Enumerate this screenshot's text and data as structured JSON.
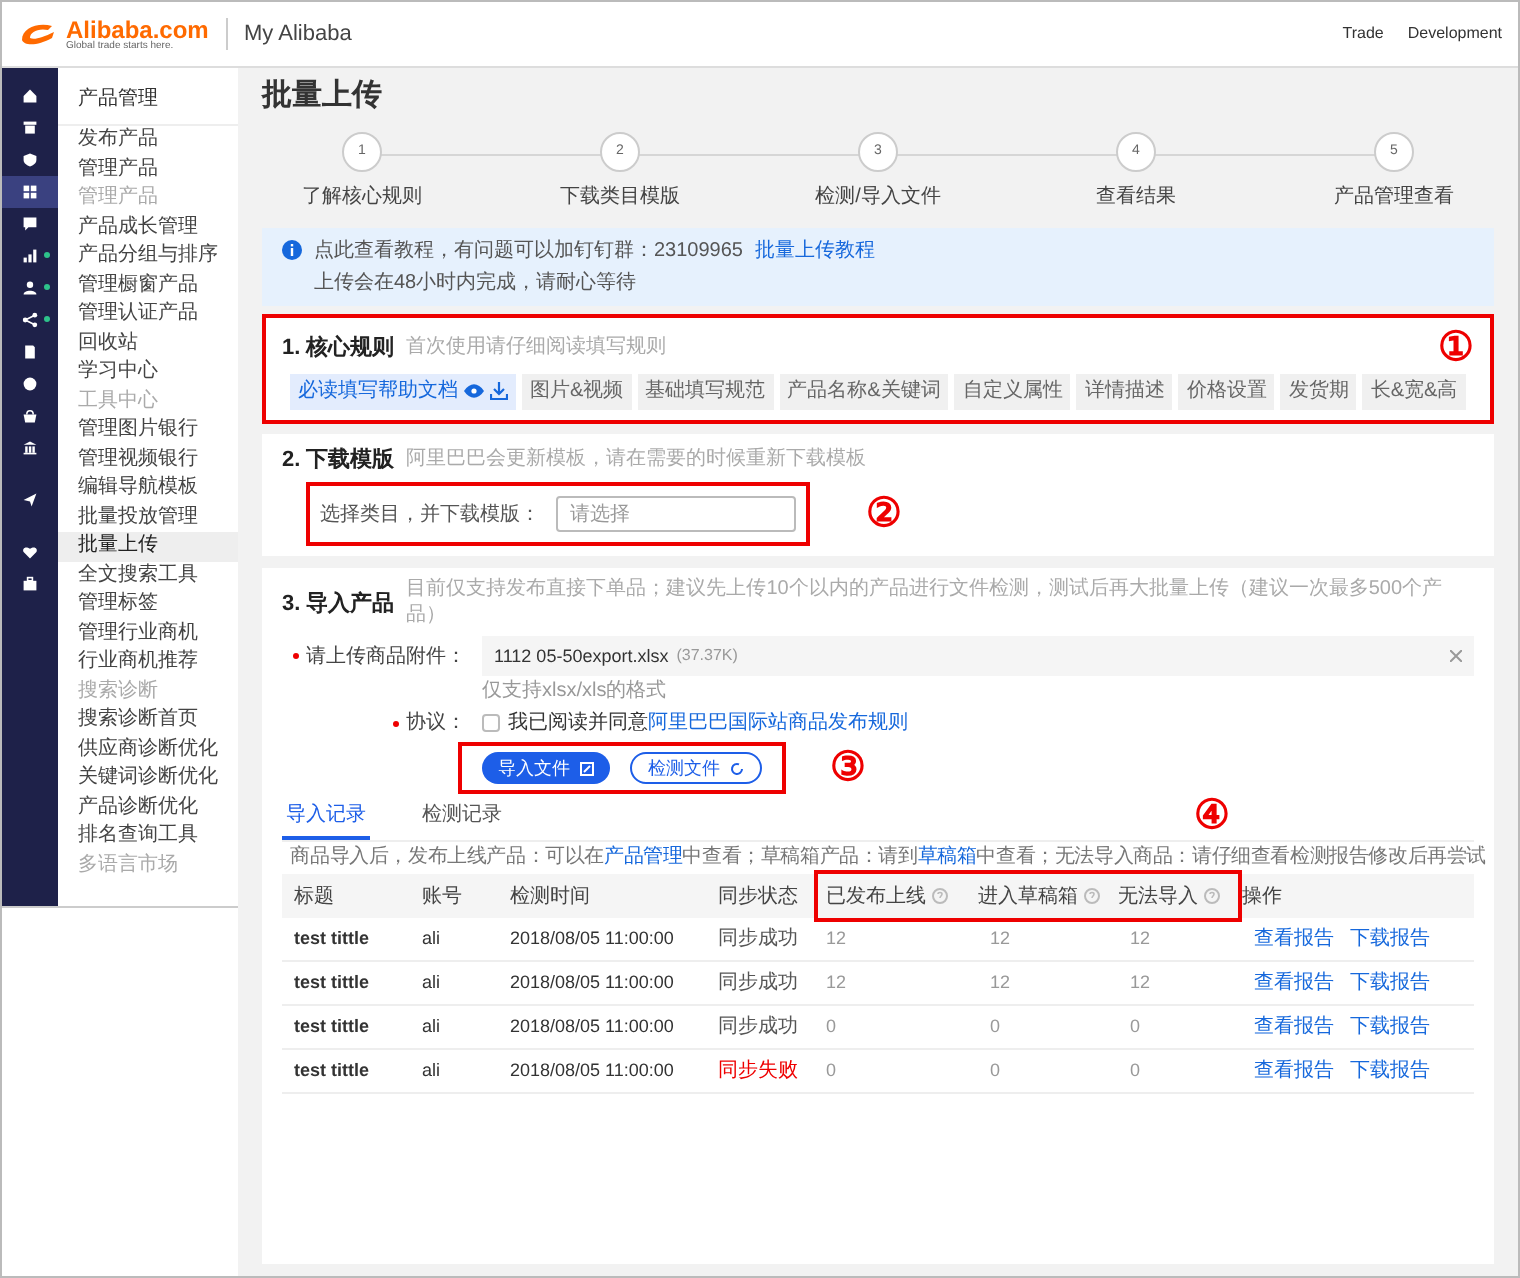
{
  "header": {
    "logo": "Alibaba.com",
    "tagline": "Global trade starts here.",
    "title": "My Alibaba",
    "nav": [
      "Trade",
      "Development"
    ]
  },
  "rail": [
    {
      "kind": "home",
      "selected": false,
      "dot": false
    },
    {
      "kind": "box",
      "selected": false,
      "dot": false
    },
    {
      "kind": "shield",
      "selected": false,
      "dot": false
    },
    {
      "kind": "grid",
      "selected": true,
      "dot": false
    },
    {
      "kind": "chat",
      "selected": false,
      "dot": false
    },
    {
      "kind": "chart",
      "selected": false,
      "dot": true
    },
    {
      "kind": "person",
      "selected": false,
      "dot": true
    },
    {
      "kind": "share",
      "selected": false,
      "dot": true
    },
    {
      "kind": "doc",
      "selected": false,
      "dot": false
    },
    {
      "kind": "globe",
      "selected": false,
      "dot": false
    },
    {
      "kind": "bag",
      "selected": false,
      "dot": false
    },
    {
      "kind": "bank",
      "selected": false,
      "dot": false
    },
    {
      "kind": "plane",
      "selected": false,
      "dot": false
    },
    {
      "kind": "heart",
      "selected": false,
      "dot": false
    },
    {
      "kind": "case",
      "selected": false,
      "dot": false
    }
  ],
  "sidebar": {
    "title": "产品管理",
    "items": [
      {
        "kind": "link",
        "label": "发布产品",
        "selected": false
      },
      {
        "kind": "link",
        "label": "管理产品",
        "selected": false
      },
      {
        "kind": "group",
        "label": "管理产品"
      },
      {
        "kind": "link",
        "label": "产品成长管理",
        "selected": false
      },
      {
        "kind": "link",
        "label": "产品分组与排序",
        "selected": false
      },
      {
        "kind": "link",
        "label": "管理橱窗产品",
        "selected": false
      },
      {
        "kind": "link",
        "label": "管理认证产品",
        "selected": false
      },
      {
        "kind": "link",
        "label": "回收站",
        "selected": false
      },
      {
        "kind": "link",
        "label": "学习中心",
        "selected": false
      },
      {
        "kind": "group",
        "label": "工具中心"
      },
      {
        "kind": "link",
        "label": "管理图片银行",
        "selected": false
      },
      {
        "kind": "link",
        "label": "管理视频银行",
        "selected": false
      },
      {
        "kind": "link",
        "label": "编辑导航模板",
        "selected": false
      },
      {
        "kind": "link",
        "label": "批量投放管理",
        "selected": false
      },
      {
        "kind": "link",
        "label": "批量上传",
        "selected": true
      },
      {
        "kind": "link",
        "label": "全文搜索工具",
        "selected": false
      },
      {
        "kind": "link",
        "label": "管理标签",
        "selected": false
      },
      {
        "kind": "link",
        "label": "管理行业商机",
        "selected": false
      },
      {
        "kind": "link",
        "label": "行业商机推荐",
        "selected": false
      },
      {
        "kind": "group",
        "label": "搜索诊断"
      },
      {
        "kind": "link",
        "label": "搜索诊断首页",
        "selected": false
      },
      {
        "kind": "link",
        "label": "供应商诊断优化",
        "selected": false
      },
      {
        "kind": "link",
        "label": "关键词诊断优化",
        "selected": false
      },
      {
        "kind": "link",
        "label": "产品诊断优化",
        "selected": false
      },
      {
        "kind": "link",
        "label": "排名查询工具",
        "selected": false
      },
      {
        "kind": "group",
        "label": "多语言市场"
      }
    ]
  },
  "page_title": "批量上传",
  "steps": [
    {
      "number": "1",
      "label": "了解核心规则"
    },
    {
      "number": "2",
      "label": "下载类目模版"
    },
    {
      "number": "3",
      "label": "检测/导入文件"
    },
    {
      "number": "4",
      "label": "查看结果"
    },
    {
      "number": "5",
      "label": "产品管理查看"
    }
  ],
  "notice": {
    "text": "点此查看教程，有问题可以加钉钉群：23109965",
    "link": "批量上传教程",
    "line2": "上传会在48小时内完成，请耐心等待"
  },
  "section1": {
    "title": "1. 核心规则",
    "hint": "首次使用请仔细阅读填写规则",
    "primary": "必读填写帮助文档",
    "chips": [
      "图片&视频",
      "基础填写规范",
      "产品名称&关键词",
      "自定义属性",
      "详情描述",
      "价格设置",
      "发货期",
      "长&宽&高"
    ],
    "marker": "①"
  },
  "section2": {
    "title": "2. 下载模版",
    "hint": "阿里巴巴会更新模板，请在需要的时候重新下载模板",
    "label": "选择类目，并下载模版：",
    "placeholder": "请选择",
    "marker": "②"
  },
  "section3": {
    "title": "3. 导入产品",
    "hint": "目前仅支持发布直接下单品；建议先上传10个以内的产品进行文件检测，测试后再大批量上传（建议一次最多500个产品）",
    "file_label": "请上传商品附件：",
    "file_name": "1112 05-50export.xlsx",
    "file_size": "(37.37K)",
    "file_note": "仅支持xlsx/xls的格式",
    "agree_label": "协议：",
    "agree_text": "我已阅读并同意",
    "agree_link": "阿里巴巴国际站商品发布规则",
    "agreed": false,
    "buttons": [
      {
        "label": "导入文件",
        "kind": "primary"
      },
      {
        "label": "检测文件",
        "kind": "outline"
      }
    ],
    "marker": "③"
  },
  "tabs": [
    {
      "label": "导入记录",
      "selected": true
    },
    {
      "label": "检测记录",
      "selected": false
    }
  ],
  "tabs_marker": "④",
  "info_line": [
    {
      "text": "商品导入后，发布上线产品：可以在",
      "link": false
    },
    {
      "text": "产品管理",
      "link": true
    },
    {
      "text": "中查看；草稿箱产品：请到",
      "link": false
    },
    {
      "text": "草稿箱",
      "link": true
    },
    {
      "text": "中查看；无法导入商品：请仔细查看检测报告修改后再尝试",
      "link": false
    }
  ],
  "table": {
    "columns": [
      {
        "label": "标题",
        "help": false,
        "highlighted": false
      },
      {
        "label": "账号",
        "help": false,
        "highlighted": false
      },
      {
        "label": "检测时间",
        "help": false,
        "highlighted": false
      },
      {
        "label": "同步状态",
        "help": false,
        "highlighted": false
      },
      {
        "label": "已发布上线",
        "help": true,
        "highlighted": true
      },
      {
        "label": "进入草稿箱",
        "help": true,
        "highlighted": true
      },
      {
        "label": "无法导入",
        "help": true,
        "highlighted": true
      },
      {
        "label": "操作",
        "help": false,
        "highlighted": false
      }
    ],
    "rows": [
      {
        "cells": [
          "test tittle",
          "ali",
          "2018/08/05 11:00:00",
          "同步成功",
          "12",
          "12",
          "12"
        ],
        "failed": false,
        "actions": [
          "查看报告",
          "下载报告"
        ]
      },
      {
        "cells": [
          "test tittle",
          "ali",
          "2018/08/05 11:00:00",
          "同步成功",
          "12",
          "12",
          "12"
        ],
        "failed": false,
        "actions": [
          "查看报告",
          "下载报告"
        ]
      },
      {
        "cells": [
          "test tittle",
          "ali",
          "2018/08/05 11:00:00",
          "同步成功",
          "0",
          "0",
          "0"
        ],
        "failed": false,
        "actions": [
          "查看报告",
          "下载报告"
        ]
      },
      {
        "cells": [
          "test tittle",
          "ali",
          "2018/08/05 11:00:00",
          "同步失败",
          "0",
          "0",
          "0"
        ],
        "failed": true,
        "actions": [
          "查看报告",
          "下载报告"
        ]
      }
    ]
  }
}
